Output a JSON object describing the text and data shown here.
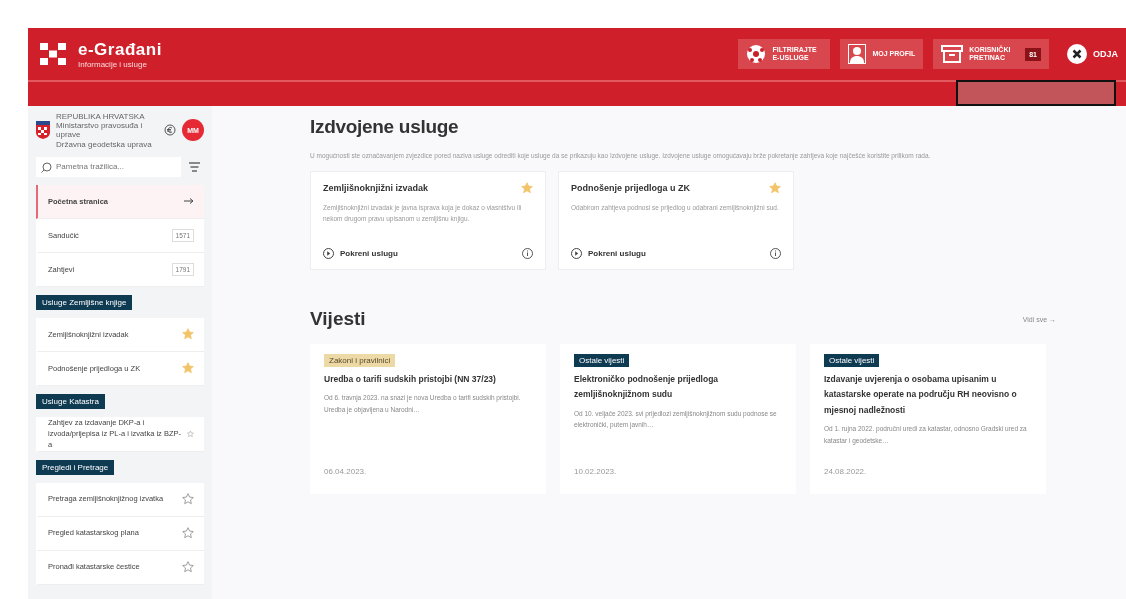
{
  "header": {
    "logo_title": "e-Građani",
    "logo_subtitle": "Informacije i usluge",
    "actions": [
      {
        "kind": "filter",
        "label": "FILTRIRAJTE E-USLUGE"
      },
      {
        "kind": "profile",
        "label": "MOJ PROFIL"
      },
      {
        "kind": "inbox",
        "label": "KORISNIČKI PRETINAC",
        "badge": "81"
      },
      {
        "kind": "logout",
        "label": "ODJA"
      }
    ]
  },
  "sidebar": {
    "ministry": [
      "REPUBLIKA HRVATSKA",
      "Ministarstvo pravosuđa i uprave",
      "Državna geodetska uprava"
    ],
    "avatar": "MM",
    "search": {
      "placeholder": "Pametna tražilica..."
    },
    "nav": [
      {
        "label": "Početna stranica",
        "selected": true,
        "kind": "arrow"
      },
      {
        "label": "Sandučić",
        "selected": false,
        "kind": "count",
        "count": "1571"
      },
      {
        "label": "Zahtjevi",
        "selected": false,
        "kind": "count",
        "count": "1791"
      }
    ],
    "sections": [
      {
        "title": "Usluge Zemljišne knjige",
        "items": [
          {
            "label": "Zemljišnoknjižni izvadak",
            "favorite": true
          },
          {
            "label": "Podnošenje prijedloga u ZK",
            "favorite": true
          }
        ]
      },
      {
        "title": "Usluge Katastra",
        "items": [
          {
            "label": "Zahtjev za izdavanje DKP-a i izvoda/prijepisa iz PL-a i izvatka iz BZP-a",
            "favorite": false
          }
        ]
      },
      {
        "title": "Pregledi i Pretrage",
        "items": [
          {
            "label": "Pretraga zemljišnoknjižnog izvatka",
            "favorite": false
          },
          {
            "label": "Pregled katastarskog plana",
            "favorite": false
          },
          {
            "label": "Pronađi katastarske čestice",
            "favorite": false
          }
        ]
      }
    ]
  },
  "featured": {
    "title": "Izdvojene usluge",
    "description": "U mogućnosti ste označavanjem zvjezdice pored naziva usluge odrediti koje usluge da se prikazuju kao Izdvojene usluge. Izdvojene usluge omogućavaju brže pokretanje zahtjeva koje najčešće koristite prilikom rada.",
    "cards": [
      {
        "title": "Zemljišnoknjižni izvadak",
        "favorite": true,
        "description": "Zemljišnoknjižni izvadak je javna isprava koja je dokaz o vlasništvu ili nekom drugom pravu upisanom u zemljišnu knjigu.",
        "action": "Pokreni uslugu"
      },
      {
        "title": "Podnošenje prijedloga u ZK",
        "favorite": true,
        "description": "Odabirom zahtjeva podnosi se prijedlog u odabrani zemljišnoknjižni sud.",
        "action": "Pokreni uslugu"
      }
    ]
  },
  "news": {
    "title": "Vijesti",
    "see_all": "Vidi sve →",
    "items": [
      {
        "tag": "Zakoni i pravilnici",
        "color": "#ecd9a6",
        "title": "Uredba o tarifi sudskih pristojbi (NN 37/23)",
        "excerpt": "Od 6. travnja 2023. na snazi je nova Uredba o tarifi sudskih pristojbi. Uredba je objavljena u Narodni…",
        "date": "06.04.2023."
      },
      {
        "tag": "Ostale vijesti",
        "color": "#0e3a52",
        "title": "Elektroničko podnošenje prijedloga zemljišnoknjižnom sudu",
        "excerpt": "Od 10. veljače 2023. svi prijedlozi zemljišnoknjižnom sudu podnose se elektronički, putem javnih…",
        "date": "10.02.2023."
      },
      {
        "tag": "Ostale vijesti",
        "color": "#0e3a52",
        "title": "Izdavanje uvjerenja o osobama upisanim u katastarske operate na području RH neovisno o mjesnoj nadležnosti",
        "excerpt": "Od 1. rujna 2022. područni uredi za katastar, odnosno Gradski ured za katastar i geodetske…",
        "date": "24.08.2022."
      }
    ]
  }
}
